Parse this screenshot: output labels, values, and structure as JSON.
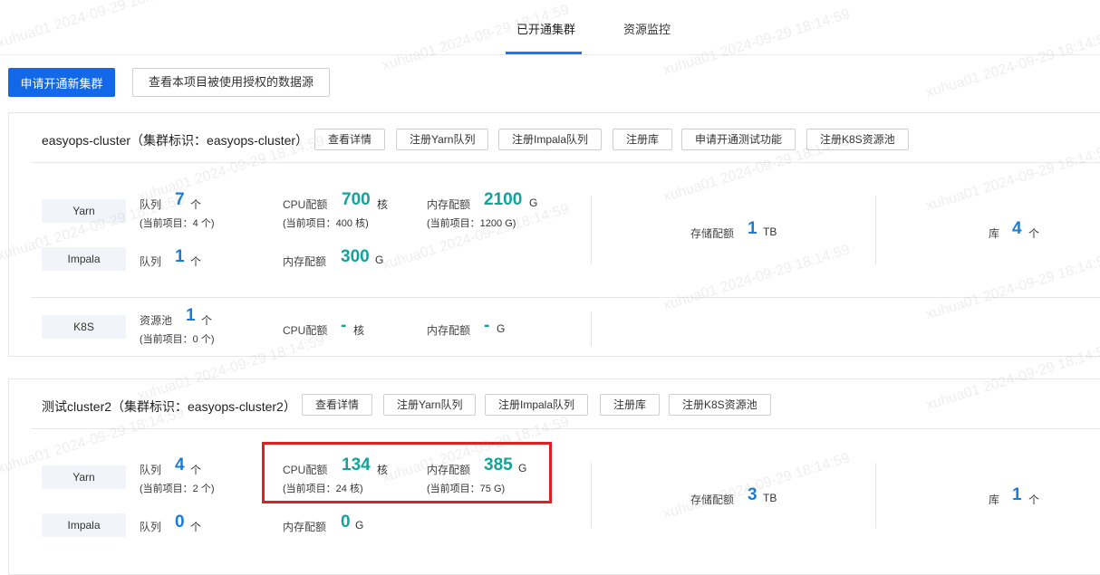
{
  "tabs": [
    "已开通集群",
    "资源监控"
  ],
  "buttons": {
    "apply_new_cluster": "申请开通新集群",
    "view_authorized_sources": "查看本项目被使用授权的数据源"
  },
  "clusters": [
    {
      "title": "easyops-cluster（集群标识：easyops-cluster）",
      "actions": [
        "查看详情",
        "注册Yarn队列",
        "注册Impala队列",
        "注册库",
        "申请开通测试功能",
        "注册K8S资源池"
      ],
      "yarn": {
        "tag": "Yarn",
        "queue_label": "队列",
        "queue_value": "7",
        "queue_unit": "个",
        "queue_sub": "(当前项目：4 个)",
        "cpu_label": "CPU配额",
        "cpu_value": "700",
        "cpu_unit": "核",
        "cpu_sub": "(当前项目：400 核)",
        "mem_label": "内存配额",
        "mem_value": "2100",
        "mem_unit": "G",
        "mem_sub": "(当前项目：1200 G)"
      },
      "impala": {
        "tag": "Impala",
        "queue_label": "队列",
        "queue_value": "1",
        "queue_unit": "个",
        "mem_label": "内存配额",
        "mem_value": "300",
        "mem_unit": "G"
      },
      "storage": {
        "label": "存储配额",
        "value": "1",
        "unit": "TB"
      },
      "db": {
        "label": "库",
        "value": "4",
        "unit": "个"
      },
      "k8s": {
        "tag": "K8S",
        "pool_label": "资源池",
        "pool_value": "1",
        "pool_unit": "个",
        "pool_sub": "(当前项目：0 个)",
        "cpu_label": "CPU配额",
        "cpu_value": "-",
        "cpu_unit": "核",
        "mem_label": "内存配额",
        "mem_value": "-",
        "mem_unit": "G"
      }
    },
    {
      "title": "测试cluster2（集群标识：easyops-cluster2）",
      "actions": [
        "查看详情",
        "注册Yarn队列",
        "注册Impala队列",
        "注册库",
        "注册K8S资源池"
      ],
      "yarn": {
        "tag": "Yarn",
        "queue_label": "队列",
        "queue_value": "4",
        "queue_unit": "个",
        "queue_sub": "(当前项目：2 个)",
        "cpu_label": "CPU配额",
        "cpu_value": "134",
        "cpu_unit": "核",
        "cpu_sub": "(当前项目：24 核)",
        "mem_label": "内存配额",
        "mem_value": "385",
        "mem_unit": "G",
        "mem_sub": "(当前项目：75 G)"
      },
      "impala": {
        "tag": "Impala",
        "queue_label": "队列",
        "queue_value": "0",
        "queue_unit": "个",
        "mem_label": "内存配额",
        "mem_value": "0",
        "mem_unit": "G"
      },
      "storage": {
        "label": "存储配额",
        "value": "3",
        "unit": "TB"
      },
      "db": {
        "label": "库",
        "value": "1",
        "unit": "个"
      }
    }
  ],
  "watermark": "xuhua01 2024-09-29 18:14:59"
}
